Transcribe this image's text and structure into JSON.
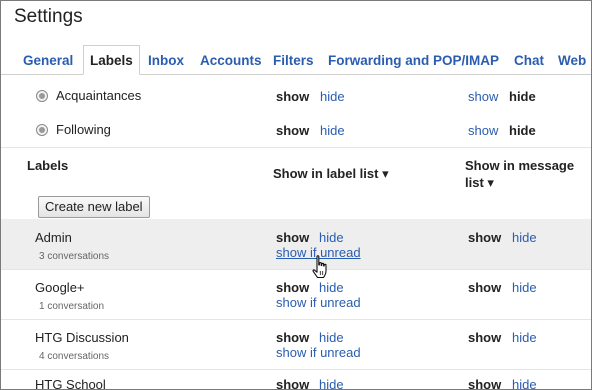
{
  "page_title": "Settings",
  "tabs": [
    {
      "label": "General"
    },
    {
      "label": "Labels"
    },
    {
      "label": "Inbox"
    },
    {
      "label": "Accounts"
    },
    {
      "label": "Filters"
    },
    {
      "label": "Forwarding and POP/IMAP"
    },
    {
      "label": "Chat"
    },
    {
      "label": "Web"
    }
  ],
  "circles": [
    {
      "name": "Acquaintances",
      "list_show": "show",
      "list_hide": "hide",
      "msg_show": "show",
      "msg_hide": "hide"
    },
    {
      "name": "Following",
      "list_show": "show",
      "list_hide": "hide",
      "msg_show": "show",
      "msg_hide": "hide"
    }
  ],
  "labels_section": {
    "heading": "Labels",
    "col_label_list": "Show in label list ▾",
    "col_message_list_1": "Show in message",
    "col_message_list_2": "list ▾",
    "create_button": "Create new label"
  },
  "labels": [
    {
      "name": "Admin",
      "count": "3 conversations",
      "show": "show",
      "hide": "hide",
      "unread": "show if unread",
      "msg_show": "show",
      "msg_hide": "hide"
    },
    {
      "name": "Google+",
      "count": "1 conversation",
      "show": "show",
      "hide": "hide",
      "unread": "show if unread",
      "msg_show": "show",
      "msg_hide": "hide"
    },
    {
      "name": "HTG Discussion",
      "count": "4 conversations",
      "show": "show",
      "hide": "hide",
      "unread": "show if unread",
      "msg_show": "show",
      "msg_hide": "hide"
    },
    {
      "name": "HTG School",
      "show": "show",
      "hide": "hide",
      "msg_show": "show",
      "msg_hide": "hide"
    }
  ],
  "colors": {
    "link": "#2a5db0",
    "hover_row": "#eeeeee"
  }
}
